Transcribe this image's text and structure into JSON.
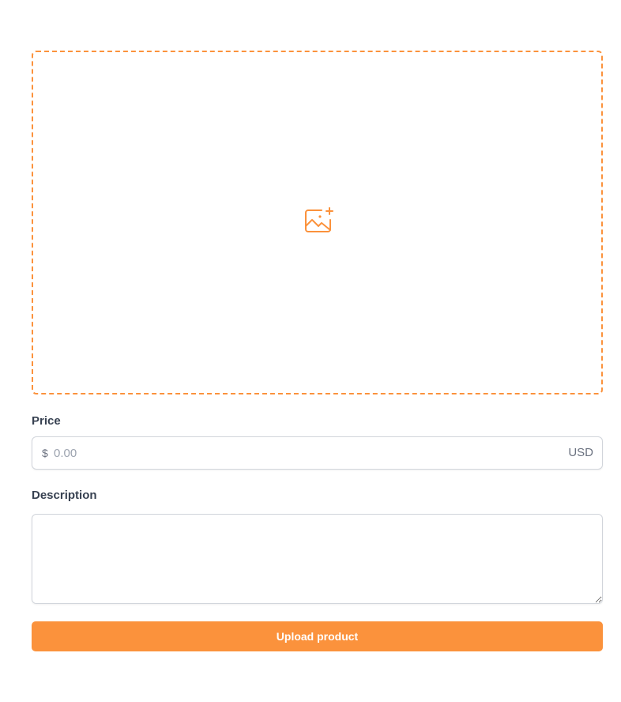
{
  "theme": {
    "accent": "#fb923c",
    "border": "#d1d5db",
    "label_text": "#374151",
    "muted_text": "#6b7280"
  },
  "dropzone": {
    "icon": "image-plus-icon"
  },
  "price": {
    "label": "Price",
    "currency_symbol": "$",
    "placeholder": "0.00",
    "value": "",
    "currency_code": "USD"
  },
  "description": {
    "label": "Description",
    "value": ""
  },
  "upload_button": {
    "label": "Upload product"
  }
}
